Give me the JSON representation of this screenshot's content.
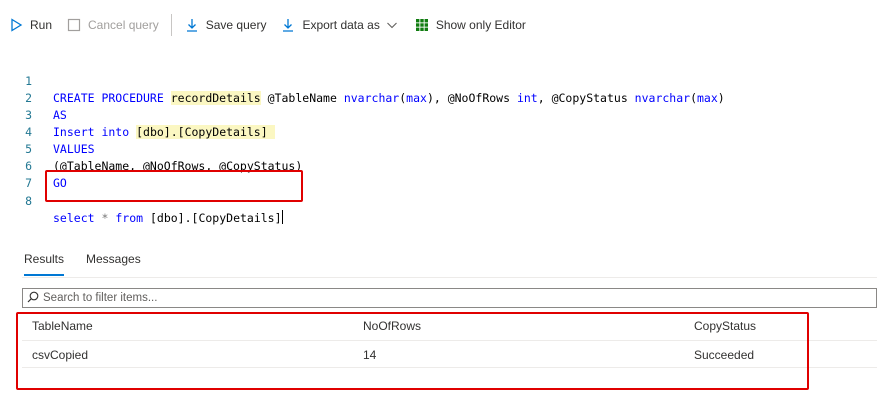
{
  "toolbar": {
    "run": "Run",
    "cancel_query": "Cancel query",
    "save_query": "Save query",
    "export_data_as": "Export data as",
    "show_only_editor": "Show only Editor"
  },
  "editor": {
    "line_numbers": [
      "1",
      "2",
      "3",
      "4",
      "5",
      "6",
      "7",
      "8"
    ],
    "lines": [
      "CREATE PROCEDURE recordDetails @TableName nvarchar(max), @NoOfRows int, @CopyStatus nvarchar(max)",
      "AS",
      "Insert into [dbo].[CopyDetails]",
      "VALUES",
      "(@TableName, @NoOfRows, @CopyStatus)",
      "GO",
      "",
      "select * from [dbo].[CopyDetails]"
    ]
  },
  "results": {
    "tabs": [
      "Results",
      "Messages"
    ],
    "active_tab": "Results",
    "filter_placeholder": "Search to filter items...",
    "columns": [
      "TableName",
      "NoOfRows",
      "CopyStatus"
    ],
    "rows": [
      [
        "csvCopied",
        "14",
        "Succeeded"
      ]
    ]
  },
  "colors": {
    "accent": "#0078d4",
    "highlight_box": "#e00000",
    "keyword": "#0000ff",
    "line_number": "#237893",
    "token_highlight": "#fbf7c2"
  }
}
